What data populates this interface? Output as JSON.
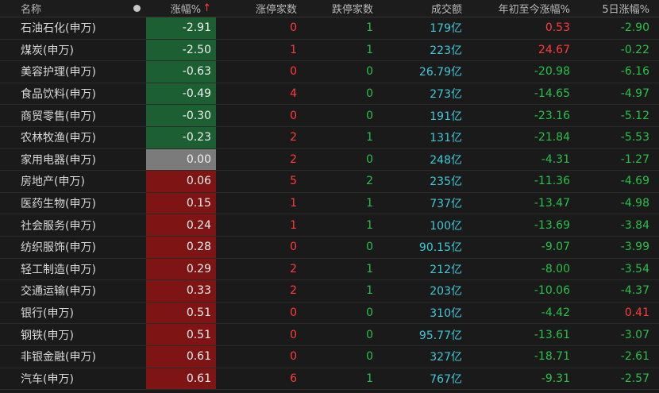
{
  "header": {
    "name": "名称",
    "change_pct": "涨幅%",
    "sort_arrow": "↑",
    "limit_up": "涨停家数",
    "limit_down": "跌停家数",
    "turnover": "成交额",
    "ytd": "年初至今涨幅%",
    "five_day": "5日涨幅%"
  },
  "colors": {
    "negative_cell": "#1b5f32",
    "zero_cell": "#7b7b7b",
    "positive_cell": "#7e1414",
    "up_red": "#ff3b3b",
    "down_green": "#27c04b",
    "amount_cyan": "#3fc8d8"
  },
  "rows": [
    {
      "name": "石油石化(申万)",
      "change": "-2.91",
      "sign": "neg",
      "up": "0",
      "down": "1",
      "amount": "179亿",
      "ytd": "0.53",
      "ytd_sign": "pos",
      "d5": "-2.90",
      "d5_sign": "neg"
    },
    {
      "name": "煤炭(申万)",
      "change": "-2.50",
      "sign": "neg",
      "up": "1",
      "down": "1",
      "amount": "223亿",
      "ytd": "24.67",
      "ytd_sign": "pos",
      "d5": "-0.22",
      "d5_sign": "neg"
    },
    {
      "name": "美容护理(申万)",
      "change": "-0.63",
      "sign": "neg",
      "up": "0",
      "down": "0",
      "amount": "26.79亿",
      "ytd": "-20.98",
      "ytd_sign": "neg",
      "d5": "-6.16",
      "d5_sign": "neg"
    },
    {
      "name": "食品饮料(申万)",
      "change": "-0.49",
      "sign": "neg",
      "up": "4",
      "down": "0",
      "amount": "273亿",
      "ytd": "-14.65",
      "ytd_sign": "neg",
      "d5": "-4.97",
      "d5_sign": "neg"
    },
    {
      "name": "商贸零售(申万)",
      "change": "-0.30",
      "sign": "neg",
      "up": "0",
      "down": "0",
      "amount": "191亿",
      "ytd": "-23.16",
      "ytd_sign": "neg",
      "d5": "-5.12",
      "d5_sign": "neg"
    },
    {
      "name": "农林牧渔(申万)",
      "change": "-0.23",
      "sign": "neg",
      "up": "2",
      "down": "1",
      "amount": "131亿",
      "ytd": "-21.84",
      "ytd_sign": "neg",
      "d5": "-5.53",
      "d5_sign": "neg"
    },
    {
      "name": "家用电器(申万)",
      "change": "0.00",
      "sign": "zero",
      "up": "2",
      "down": "0",
      "amount": "248亿",
      "ytd": "-4.31",
      "ytd_sign": "neg",
      "d5": "-1.27",
      "d5_sign": "neg"
    },
    {
      "name": "房地产(申万)",
      "change": "0.06",
      "sign": "pos",
      "up": "5",
      "down": "2",
      "amount": "235亿",
      "ytd": "-11.36",
      "ytd_sign": "neg",
      "d5": "-4.69",
      "d5_sign": "neg"
    },
    {
      "name": "医药生物(申万)",
      "change": "0.15",
      "sign": "pos",
      "up": "1",
      "down": "1",
      "amount": "737亿",
      "ytd": "-13.47",
      "ytd_sign": "neg",
      "d5": "-4.98",
      "d5_sign": "neg"
    },
    {
      "name": "社会服务(申万)",
      "change": "0.24",
      "sign": "pos",
      "up": "1",
      "down": "1",
      "amount": "100亿",
      "ytd": "-13.69",
      "ytd_sign": "neg",
      "d5": "-3.84",
      "d5_sign": "neg"
    },
    {
      "name": "纺织服饰(申万)",
      "change": "0.28",
      "sign": "pos",
      "up": "0",
      "down": "0",
      "amount": "90.15亿",
      "ytd": "-9.07",
      "ytd_sign": "neg",
      "d5": "-3.99",
      "d5_sign": "neg"
    },
    {
      "name": "轻工制造(申万)",
      "change": "0.29",
      "sign": "pos",
      "up": "2",
      "down": "1",
      "amount": "212亿",
      "ytd": "-8.00",
      "ytd_sign": "neg",
      "d5": "-3.54",
      "d5_sign": "neg"
    },
    {
      "name": "交通运输(申万)",
      "change": "0.33",
      "sign": "pos",
      "up": "2",
      "down": "1",
      "amount": "203亿",
      "ytd": "-10.06",
      "ytd_sign": "neg",
      "d5": "-4.37",
      "d5_sign": "neg"
    },
    {
      "name": "银行(申万)",
      "change": "0.51",
      "sign": "pos",
      "up": "0",
      "down": "0",
      "amount": "310亿",
      "ytd": "-4.42",
      "ytd_sign": "neg",
      "d5": "0.41",
      "d5_sign": "pos"
    },
    {
      "name": "钢铁(申万)",
      "change": "0.51",
      "sign": "pos",
      "up": "0",
      "down": "0",
      "amount": "95.77亿",
      "ytd": "-13.61",
      "ytd_sign": "neg",
      "d5": "-3.07",
      "d5_sign": "neg"
    },
    {
      "name": "非银金融(申万)",
      "change": "0.61",
      "sign": "pos",
      "up": "0",
      "down": "0",
      "amount": "327亿",
      "ytd": "-18.71",
      "ytd_sign": "neg",
      "d5": "-2.61",
      "d5_sign": "neg"
    },
    {
      "name": "汽车(申万)",
      "change": "0.61",
      "sign": "pos",
      "up": "6",
      "down": "1",
      "amount": "767亿",
      "ytd": "-9.31",
      "ytd_sign": "neg",
      "d5": "-2.57",
      "d5_sign": "neg"
    }
  ]
}
